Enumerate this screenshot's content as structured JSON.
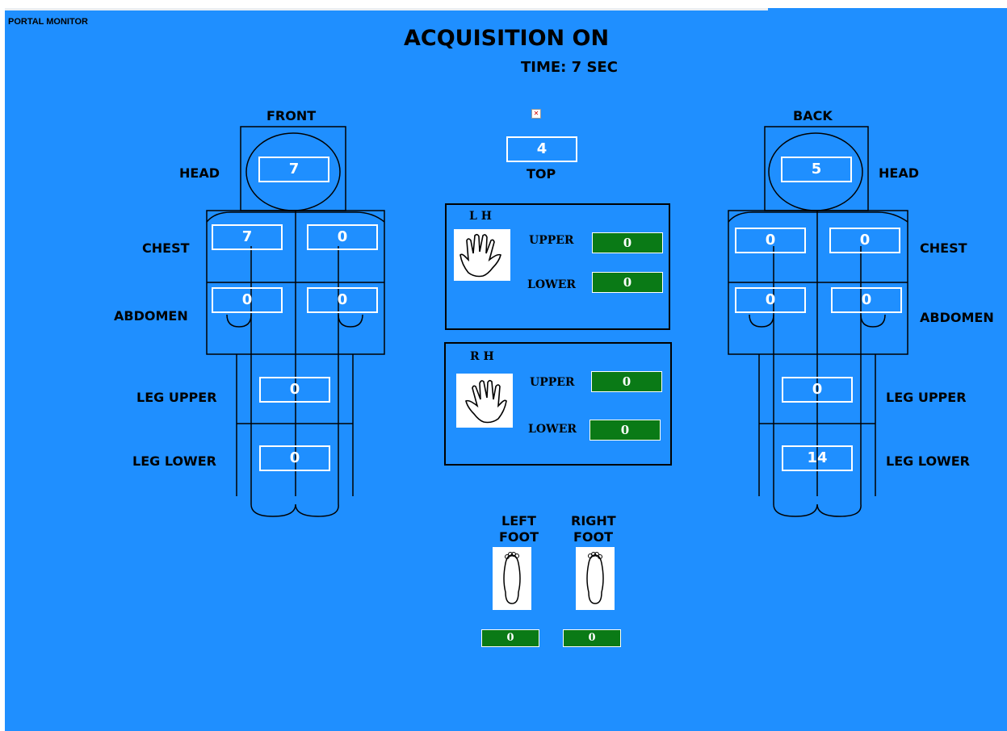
{
  "app": {
    "title": "PORTAL MONITOR"
  },
  "header": {
    "status": "ACQUISITION ON",
    "time": "TIME: 7 SEC"
  },
  "top": {
    "label": "TOP",
    "value": "4"
  },
  "front": {
    "title": "FRONT",
    "labels": {
      "head": "HEAD",
      "chest": "CHEST",
      "abdomen": "ABDOMEN",
      "leg_upper": "LEG UPPER",
      "leg_lower": "LEG LOWER"
    },
    "values": {
      "head": "7",
      "chest_left": "7",
      "chest_right": "0",
      "abdomen_left": "0",
      "abdomen_right": "0",
      "leg_upper": "0",
      "leg_lower": "0"
    }
  },
  "back": {
    "title": "BACK",
    "labels": {
      "head": "HEAD",
      "chest": "CHEST",
      "abdomen": "ABDOMEN",
      "leg_upper": "LEG UPPER",
      "leg_lower": "LEG LOWER"
    },
    "values": {
      "head": "5",
      "chest_left": "0",
      "chest_right": "0",
      "abdomen_left": "0",
      "abdomen_right": "0",
      "leg_upper": "0",
      "leg_lower": "14"
    }
  },
  "left_hand": {
    "title": "L H",
    "upper_label": "UPPER",
    "lower_label": "LOWER",
    "upper": "0",
    "lower": "0"
  },
  "right_hand": {
    "title": "R H",
    "upper_label": "UPPER",
    "lower_label": "LOWER",
    "upper": "0",
    "lower": "0"
  },
  "feet": {
    "left_label_1": "LEFT",
    "left_label_2": "FOOT",
    "right_label_1": "RIGHT",
    "right_label_2": "FOOT",
    "left": "0",
    "right": "0"
  },
  "colors": {
    "background": "#1f8fff",
    "value_green": "#0a7a16"
  },
  "icons": [
    "broken-image-icon",
    "hand-icon",
    "foot-icon"
  ]
}
